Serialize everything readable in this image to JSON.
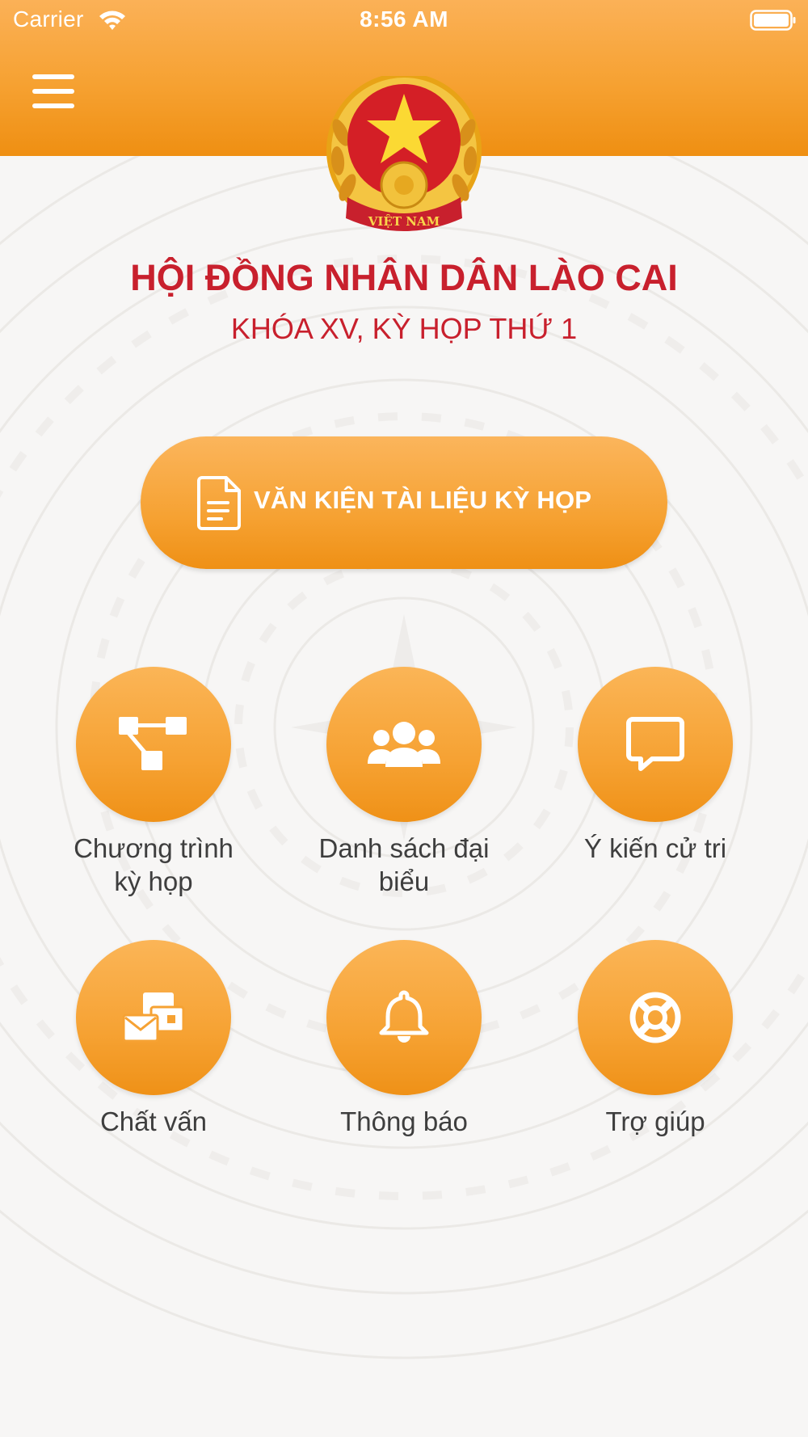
{
  "status_bar": {
    "carrier": "Carrier",
    "time": "8:56 AM"
  },
  "header": {
    "menu_icon": "hamburger-menu-icon",
    "emblem_icon": "vietnam-national-emblem",
    "emblem_text": "VIỆT NAM",
    "background_color": "#f6a131"
  },
  "title": "HỘI ĐỒNG NHÂN DÂN LÀO CAI",
  "subtitle": "KHÓA XV, KỲ HỌP THỨ 1",
  "primary_button": {
    "label": "VĂN KIỆN TÀI LIỆU KỲ HỌP",
    "icon": "document-icon"
  },
  "menu_tiles": [
    {
      "line1": "Chương trình",
      "line2": "kỳ họp",
      "icon": "agenda-flow-icon"
    },
    {
      "line1": "Danh sách đại",
      "line2": "biểu",
      "icon": "delegates-group-icon"
    },
    {
      "line1": "Ý kiến cử tri",
      "line2": "",
      "icon": "chat-bubble-icon"
    },
    {
      "line1": "Chất vấn",
      "line2": "",
      "icon": "mail-cards-icon"
    },
    {
      "line1": "Thông báo",
      "line2": "",
      "icon": "bell-icon"
    },
    {
      "line1": "Trợ giúp",
      "line2": "",
      "icon": "lifebuoy-icon"
    }
  ],
  "colors": {
    "accent_orange": "#f6a233",
    "title_red": "#c8202d",
    "label_gray": "#3e3e3e"
  }
}
